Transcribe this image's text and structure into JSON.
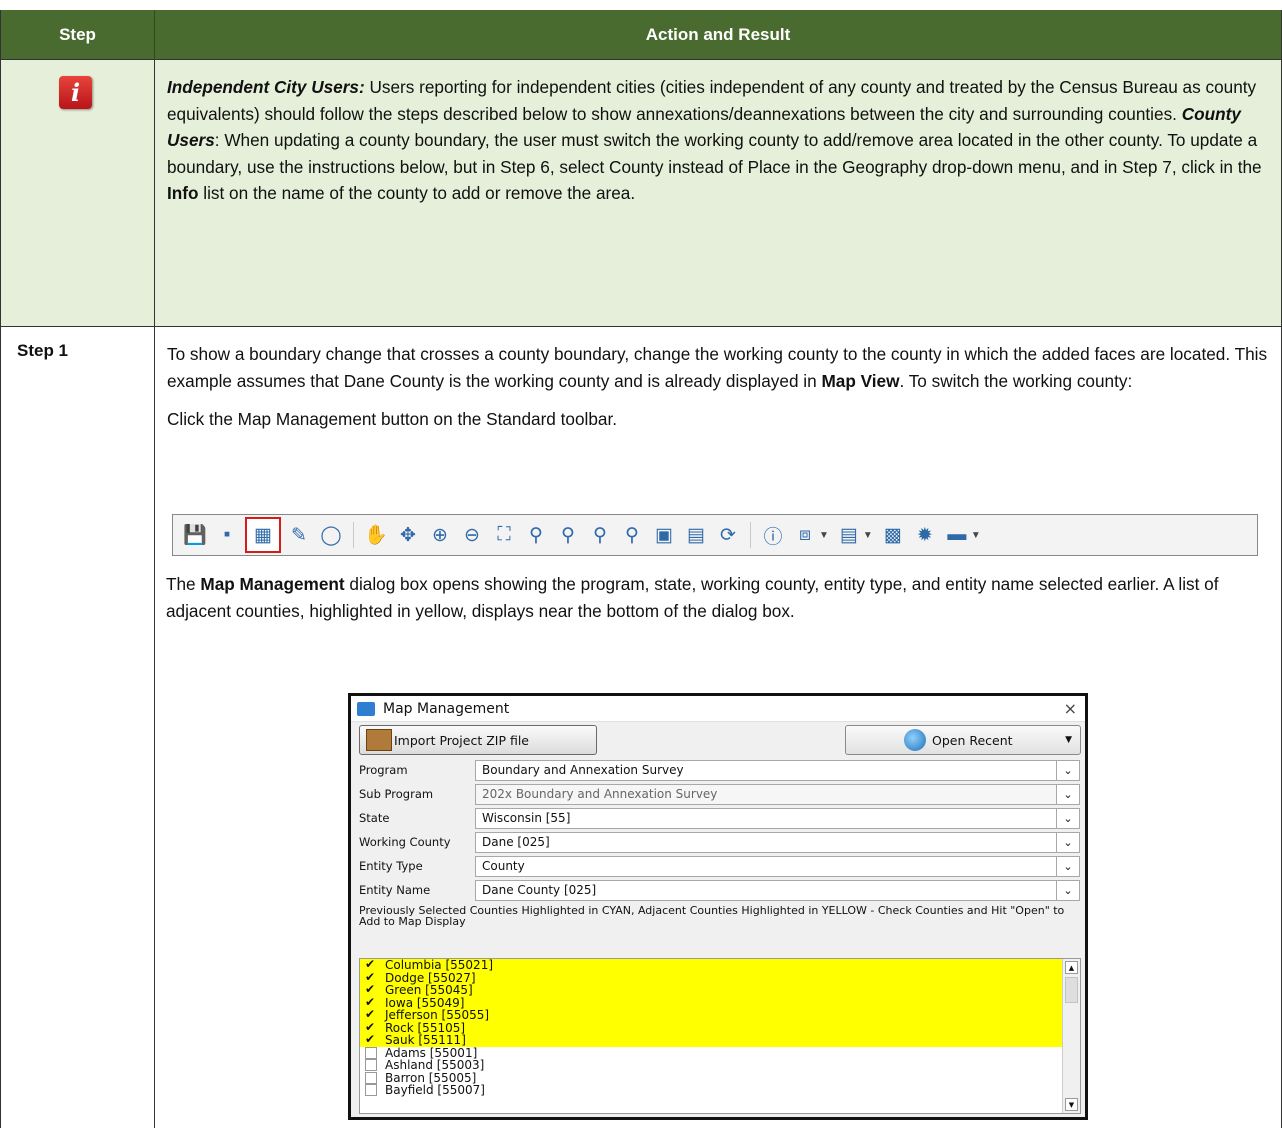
{
  "table": {
    "headers": {
      "step": "Step",
      "action": "Action and Result"
    }
  },
  "note": {
    "icon": "info-icon",
    "p1_lead": "Independent City Users:",
    "p1_body": " Users reporting for independent cities (cities independent of any county and treated by the Census Bureau as county equivalents) should follow the steps described below to show annexations/deannexations between the city and surrounding counties. ",
    "p2_lead": "County Users",
    "p2_body": ": When updating a county boundary, the user must switch the working county to add/remove area located in the other county. To update a boundary, use the instructions below, but in Step 6, select County instead of Place in the Geography drop-down menu, and in Step 7, click in the ",
    "p2_bold": "Info",
    "p2_tail": " list on the name of the county to add or remove the area."
  },
  "step1": {
    "label": "Step 1",
    "para1_a": "To show a boundary change that crosses a county boundary, change the working county to the county in which the added faces are located. This example assumes that Dane County is the working county and is already displayed in ",
    "para1_bold": "Map View",
    "para1_b": ". To switch the working county:",
    "para2": "Click the Map Management button on the Standard toolbar.",
    "para3_a": "The ",
    "para3_bold": "Map Management",
    "para3_b": " dialog box opens showing the program, state, working county, entity type, and entity name selected earlier. A list of adjacent counties, highlighted in yellow, displays near the bottom of the dialog box."
  },
  "toolbar": {
    "icons": [
      "save-icon",
      "layers-icon",
      "map-management-icon",
      "brush-icon",
      "globe-icon",
      "pan-hand-icon",
      "pan-arrows-icon",
      "zoom-in-icon",
      "zoom-out-icon",
      "zoom-full-icon",
      "zoom-layer-icon",
      "zoom-selection-icon",
      "zoom-last-icon",
      "zoom-next-icon",
      "bookmark-new-icon",
      "bookmark-icon",
      "refresh-icon",
      "identify-icon",
      "select-icon",
      "attribute-table-icon",
      "deselect-icon",
      "settings-icon",
      "measure-icon"
    ]
  },
  "dialog": {
    "title": "Map Management",
    "close": "×",
    "import_label": "Import Project ZIP file",
    "recent_label": "Open Recent",
    "fields": [
      {
        "label": "Program",
        "value": "Boundary and Annexation Survey"
      },
      {
        "label": "Sub Program",
        "value": "202x Boundary and Annexation Survey"
      },
      {
        "label": "State",
        "value": "Wisconsin [55]"
      },
      {
        "label": "Working County",
        "value": "Dane [025]"
      },
      {
        "label": "Entity Type",
        "value": "County"
      },
      {
        "label": "Entity Name",
        "value": "Dane County [025]"
      }
    ],
    "note": "Previously Selected Counties Highlighted in CYAN, Adjacent Counties Highlighted in YELLOW - Check Counties and Hit \"Open\" to Add to Map Display",
    "counties": [
      {
        "name": "Columbia [55021]",
        "checked": true,
        "highlight": "#ffff00"
      },
      {
        "name": "Dodge [55027]",
        "checked": true,
        "highlight": "#ffff00"
      },
      {
        "name": "Green [55045]",
        "checked": true,
        "highlight": "#ffff00"
      },
      {
        "name": "Iowa [55049]",
        "checked": true,
        "highlight": "#ffff00"
      },
      {
        "name": "Jefferson [55055]",
        "checked": true,
        "highlight": "#ffff00"
      },
      {
        "name": "Rock [55105]",
        "checked": true,
        "highlight": "#ffff00"
      },
      {
        "name": "Sauk [55111]",
        "checked": true,
        "highlight": "#ffff00"
      },
      {
        "name": "Adams [55001]",
        "checked": false,
        "highlight": ""
      },
      {
        "name": "Ashland [55003]",
        "checked": false,
        "highlight": ""
      },
      {
        "name": "Barron [55005]",
        "checked": false,
        "highlight": ""
      },
      {
        "name": "Bayfield [55007]",
        "checked": false,
        "highlight": ""
      }
    ]
  },
  "colors": {
    "header_green": "#4a6b2f",
    "note_bg": "#e6efd9",
    "county_highlight": "#ffff00",
    "toolbar_highlight": "#d61b1b"
  }
}
